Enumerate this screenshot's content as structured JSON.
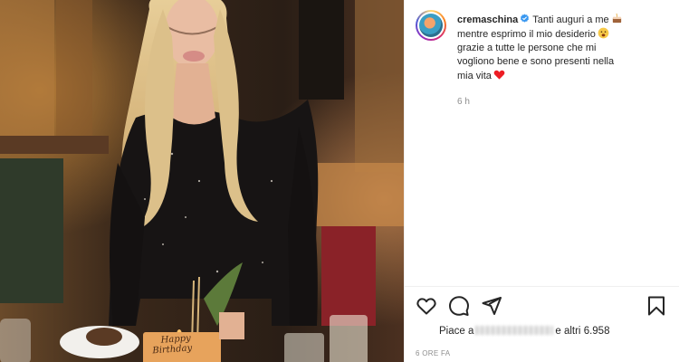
{
  "post": {
    "username": "cremaschina",
    "caption_line1": "Tanti auguri a me",
    "caption_line2": "mentre esprimo il mio desiderio",
    "caption_line3": "grazie a tutte le persone che mi",
    "caption_line4": "vogliono bene e sono presenti nella",
    "caption_line5": "mia vita",
    "time_short": "6 h",
    "likes_prefix": "Piace a",
    "likes_suffix": "e altri",
    "likes_count": "6.958",
    "date_full": "6 ORE FA"
  },
  "photo": {
    "cake_plaque_line1": "Happy",
    "cake_plaque_line2": "Birthday"
  },
  "icons": {
    "like": "heart-icon",
    "comment": "comment-icon",
    "share": "share-icon",
    "save": "bookmark-icon",
    "verified": "verified-badge-icon"
  },
  "colors": {
    "verified_blue": "#3897f0",
    "heart_red": "#ed1d24",
    "text_muted": "#8e8e8e"
  }
}
